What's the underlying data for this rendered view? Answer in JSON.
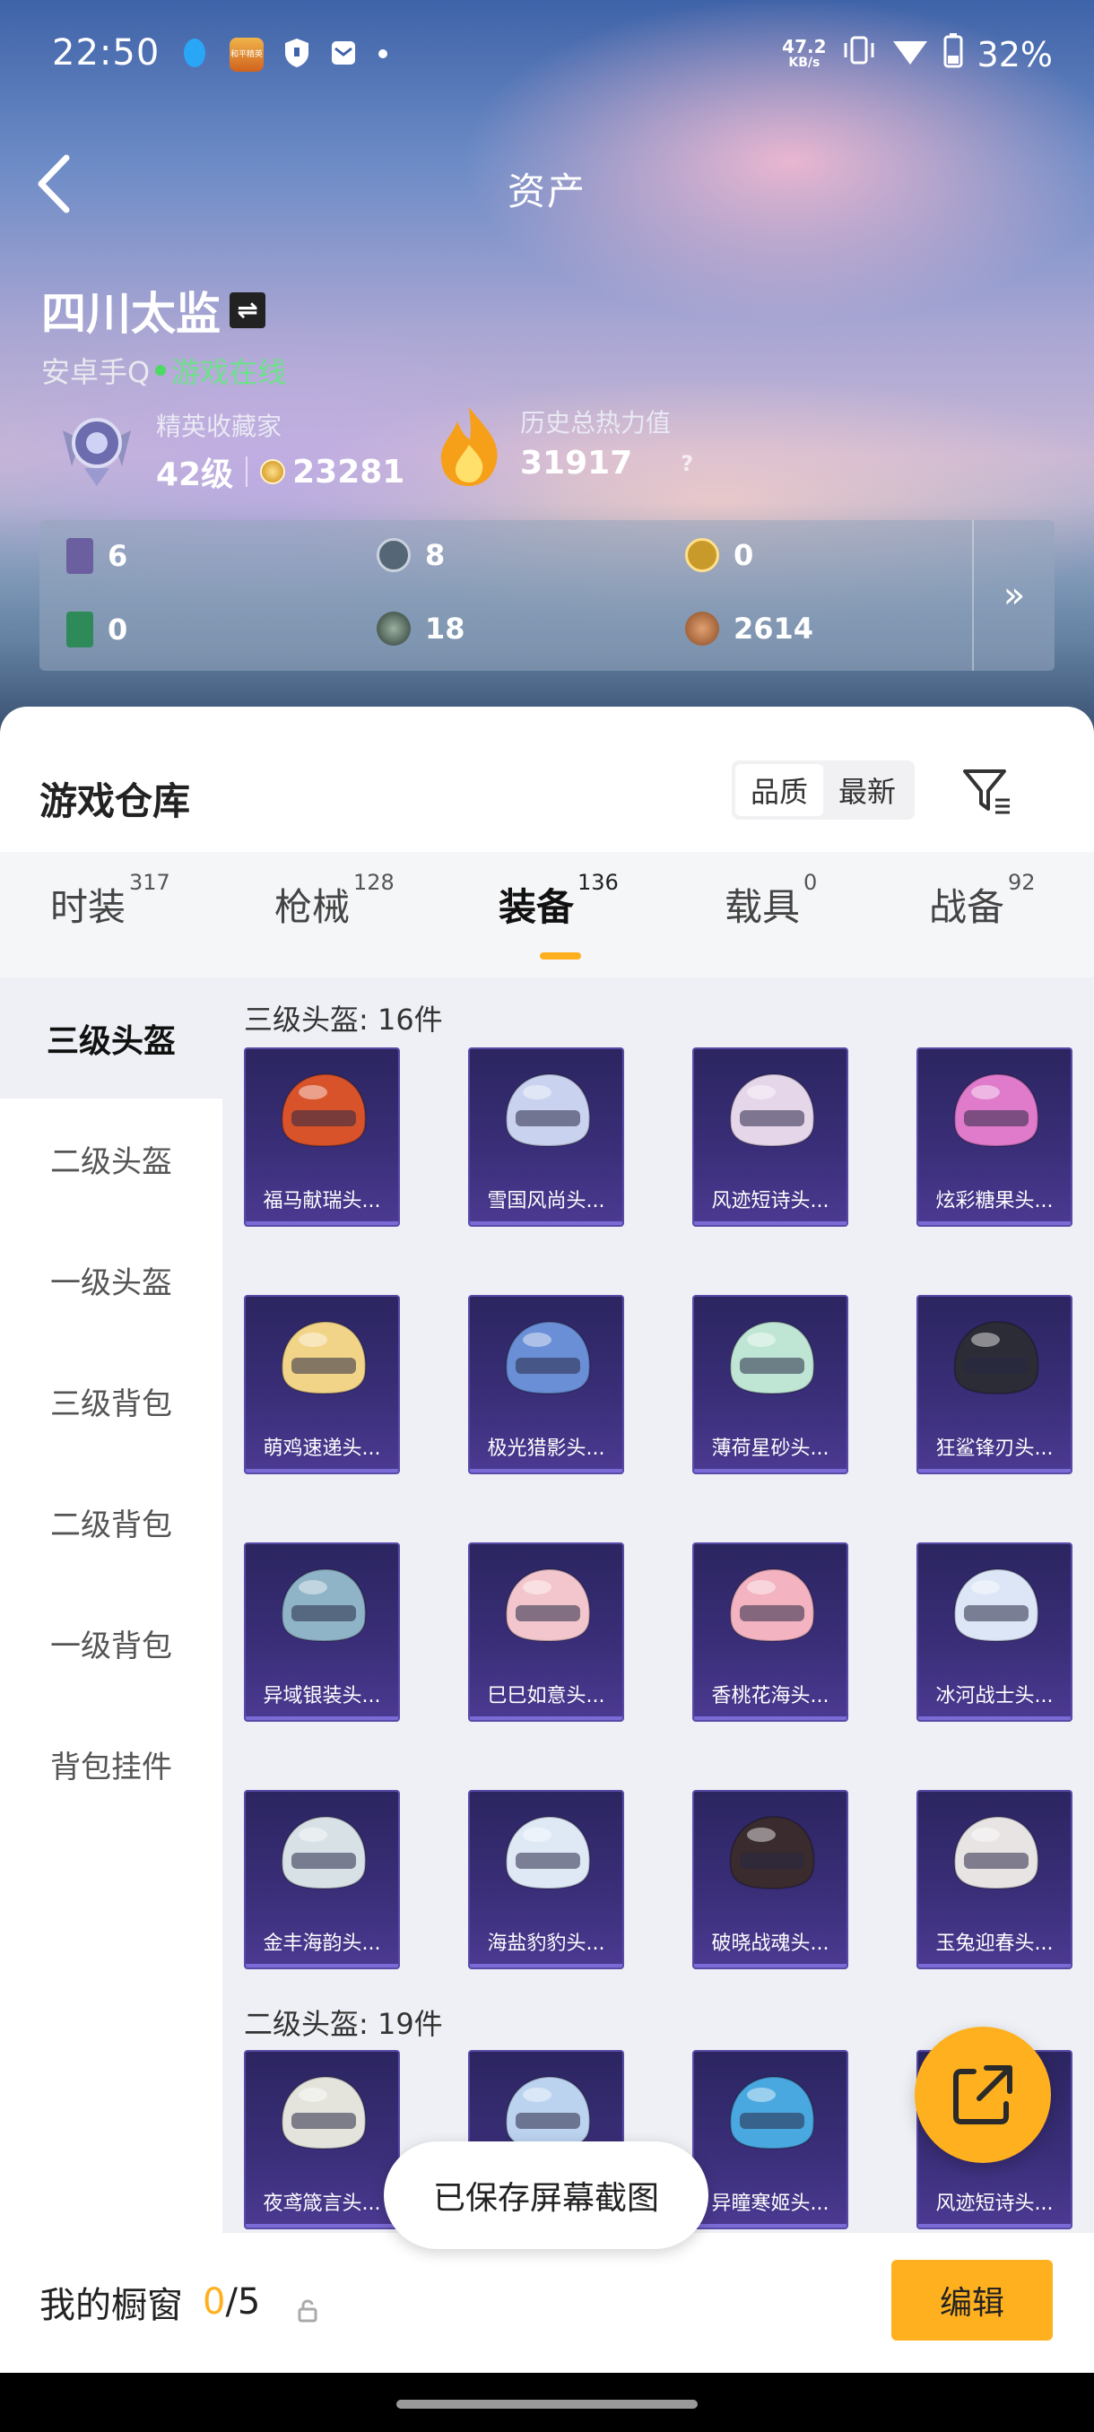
{
  "status_bar": {
    "time": "22:50",
    "net_speed_value": "47.2",
    "net_speed_unit": "KB/s",
    "battery": "32%",
    "app_icon_text": "和平精英"
  },
  "header": {
    "back_icon": "chevron-left-icon",
    "title": "资产"
  },
  "user": {
    "name": "四川太监",
    "platform": "安卓手Q",
    "status": "游戏在线"
  },
  "stats": {
    "collector_label": "精英收藏家",
    "collector_level": "42级",
    "collector_points": "23281",
    "heat_label": "历史总热力值",
    "heat_value": "31917",
    "heat_help": "?"
  },
  "resources": [
    {
      "icon": "card-icon",
      "value": "6",
      "color": "#6b5fa0"
    },
    {
      "icon": "s-coin-icon",
      "value": "8",
      "color": "#556677"
    },
    {
      "icon": "a-coin-icon",
      "value": "0",
      "color": "#c89a2a"
    },
    {
      "icon": "green-card-icon",
      "value": "0",
      "color": "#2f8a5a"
    },
    {
      "icon": "orb-icon",
      "value": "18",
      "color": "#3f5a4a"
    },
    {
      "icon": "bronze-coin-icon",
      "value": "2614",
      "color": "#a0603a"
    }
  ],
  "resources_more": "»",
  "warehouse": {
    "title": "游戏仓库",
    "sort_options": [
      "品质",
      "最新"
    ],
    "sort_selected": "品质"
  },
  "tabs": [
    {
      "label": "时装",
      "count": "317"
    },
    {
      "label": "枪械",
      "count": "128"
    },
    {
      "label": "装备",
      "count": "136"
    },
    {
      "label": "载具",
      "count": "0"
    },
    {
      "label": "战备",
      "count": "92"
    }
  ],
  "active_tab": "装备",
  "sidebar": [
    "三级头盔",
    "二级头盔",
    "一级头盔",
    "三级背包",
    "二级背包",
    "一级背包",
    "背包挂件"
  ],
  "sections": [
    {
      "title": "三级头盔: 16件",
      "items": [
        {
          "name": "福马献瑞头...",
          "color": "#d9532a"
        },
        {
          "name": "雪国风尚头...",
          "color": "#c9d2ee"
        },
        {
          "name": "风迹短诗头...",
          "color": "#e6d6ea"
        },
        {
          "name": "炫彩糖果头...",
          "color": "#e07acb"
        },
        {
          "name": "萌鸡速递头...",
          "color": "#f2d488"
        },
        {
          "name": "极光猎影头...",
          "color": "#6a8fd6"
        },
        {
          "name": "薄荷星砂头...",
          "color": "#bfe6d4"
        },
        {
          "name": "狂鲨锋刃头...",
          "color": "#2c2c36"
        },
        {
          "name": "异域银装头...",
          "color": "#8fb3c7"
        },
        {
          "name": "巳巳如意头...",
          "color": "#f2c6cc"
        },
        {
          "name": "香桃花海头...",
          "color": "#f3b3c0"
        },
        {
          "name": "冰河战士头...",
          "color": "#dce6f6"
        },
        {
          "name": "金丰海韵头...",
          "color": "#d8e2e6"
        },
        {
          "name": "海盐豹豹头...",
          "color": "#dfe9f6"
        },
        {
          "name": "破晓战魂头...",
          "color": "#3a2b2e"
        },
        {
          "name": "玉兔迎春头...",
          "color": "#e8e4e4"
        }
      ]
    },
    {
      "title": "二级头盔: 19件",
      "items": [
        {
          "name": "夜鸢箴言头...",
          "color": "#e4e4dc"
        },
        {
          "name": "",
          "color": "#bcd3f0"
        },
        {
          "name": "异瞳寒姬头...",
          "color": "#4aa8e0"
        },
        {
          "name": "风迹短诗头...",
          "color": "#e6d6ea"
        }
      ]
    }
  ],
  "toast": "已保存屏幕截图",
  "showcase": {
    "label": "我的橱窗",
    "current": "0",
    "total": "/5",
    "edit_label": "编辑"
  }
}
